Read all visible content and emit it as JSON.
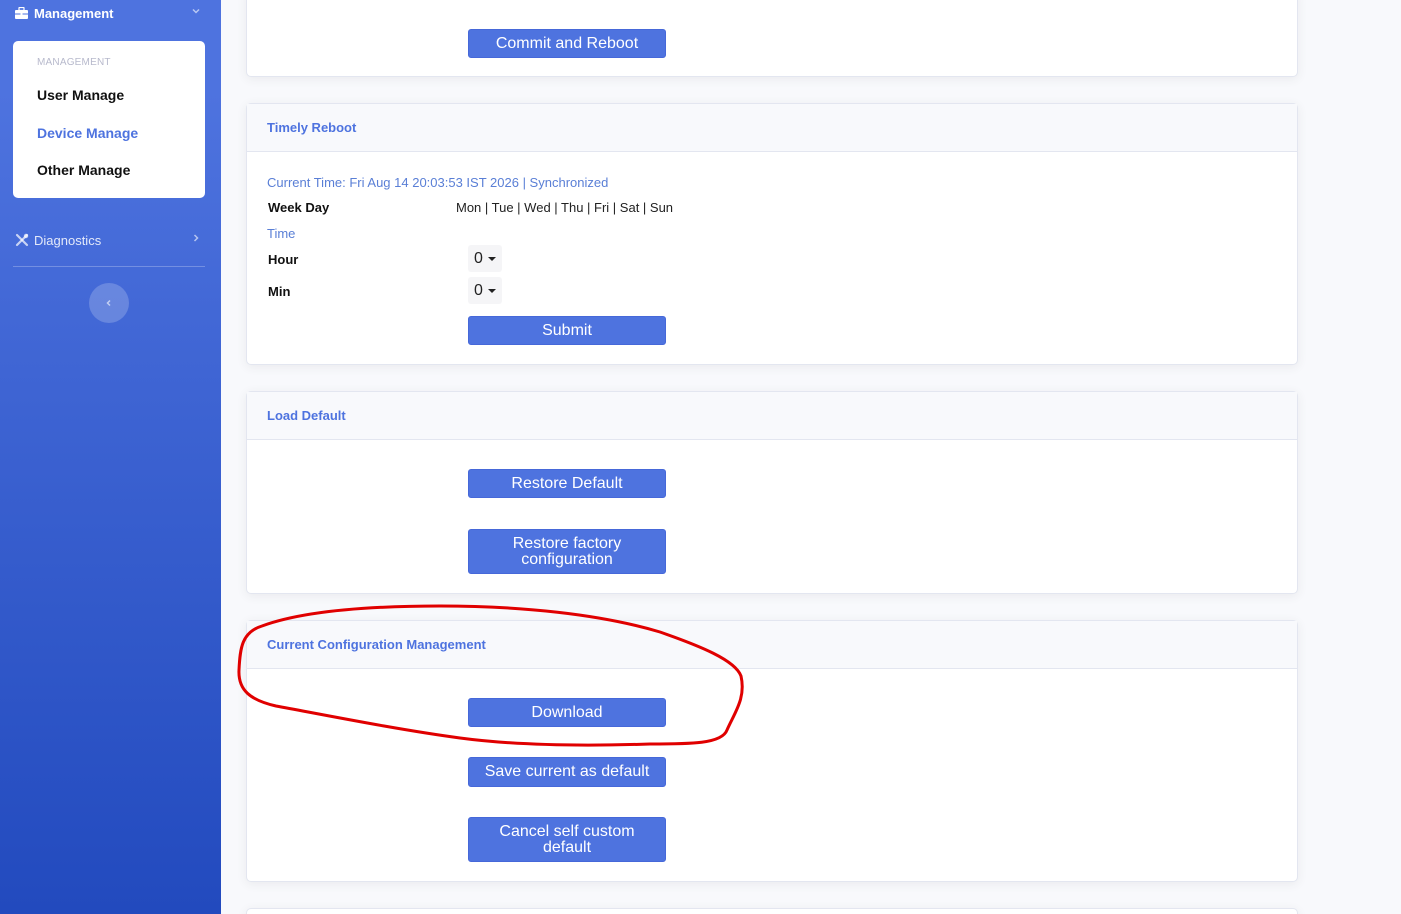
{
  "sidebar": {
    "management_label": "Management",
    "management_submenu_header": "MANAGEMENT",
    "items": [
      "User Manage",
      "Device Manage",
      "Other Manage"
    ],
    "diagnostics_label": "Diagnostics"
  },
  "cards": {
    "top": {
      "button": "Commit and Reboot"
    },
    "timely_reboot": {
      "title": "Timely Reboot",
      "current_time": "Current Time: Fri Aug 14 20:03:53 IST 2026 | Synchronized",
      "week_day_label": "Week Day",
      "week_days": "Mon | Tue | Wed | Thu | Fri | Sat | Sun",
      "time_label": "Time",
      "hour_label": "Hour",
      "hour_value": "0",
      "min_label": "Min",
      "min_value": "0",
      "submit": "Submit"
    },
    "load_default": {
      "title": "Load Default",
      "restore_default": "Restore Default",
      "restore_factory": "Restore factory configuration"
    },
    "current_config": {
      "title": "Current Configuration Management",
      "download": "Download",
      "save_default": "Save current as default",
      "cancel_custom": "Cancel self custom default"
    }
  },
  "colors": {
    "primary": "#4e73df",
    "annotation": "#e00000"
  }
}
